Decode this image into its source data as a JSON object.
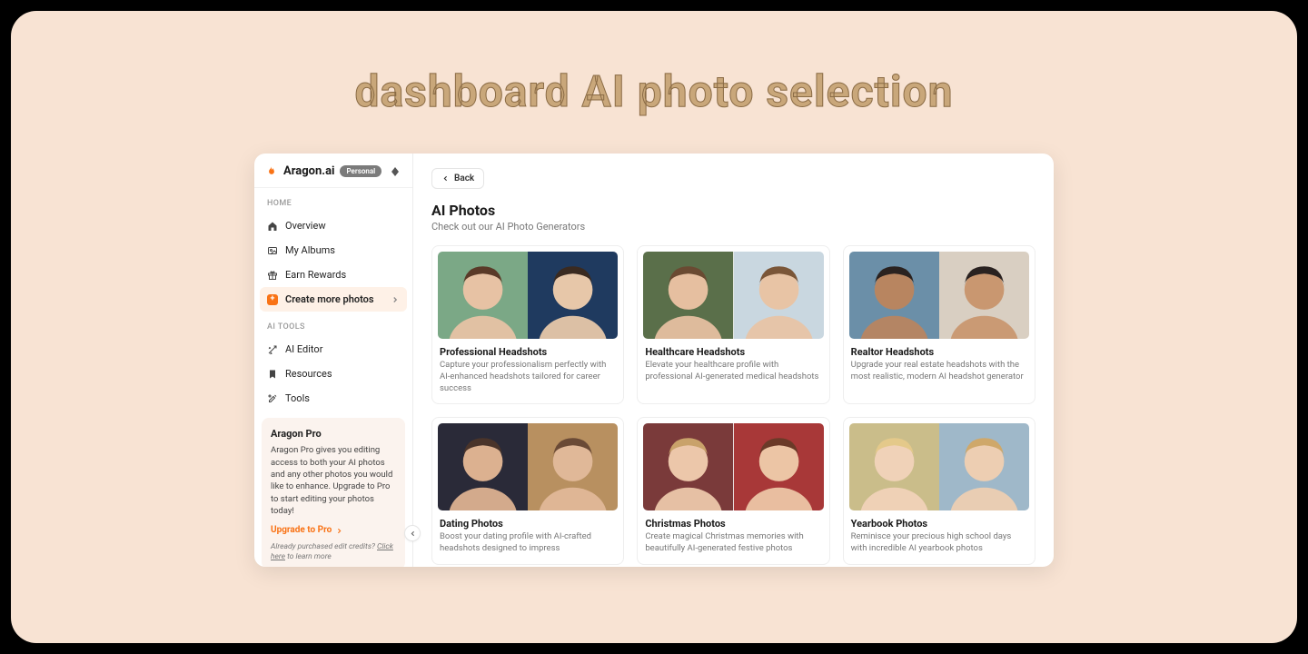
{
  "annotation": {
    "title": "dashboard AI photo selection"
  },
  "brand": {
    "name": "Aragon.ai",
    "badge": "Personal"
  },
  "sidebar": {
    "home_label": "HOME",
    "aitools_label": "AI TOOLS",
    "items": {
      "overview": "Overview",
      "my_albums": "My Albums",
      "earn_rewards": "Earn Rewards",
      "create_more": "Create more photos",
      "ai_editor": "AI Editor",
      "resources": "Resources",
      "tools": "Tools"
    },
    "pro": {
      "title": "Aragon Pro",
      "body": "Aragon Pro gives you editing access to both your AI photos and any other photos you would like to enhance. Upgrade to Pro to start editing your photos today!",
      "cta": "Upgrade to Pro",
      "fineprint_prefix": "Already purchased edit credits? ",
      "fineprint_link": "Click here",
      "fineprint_suffix": " to learn more"
    }
  },
  "main": {
    "back": "Back",
    "title": "AI Photos",
    "subtitle": "Check out our AI Photo Generators",
    "cards": [
      {
        "title": "Professional Headshots",
        "desc": "Capture your professionalism perfectly with AI-enhanced headshots tailored for career success"
      },
      {
        "title": "Healthcare Headshots",
        "desc": "Elevate your healthcare profile with professional AI-generated medical headshots"
      },
      {
        "title": "Realtor Headshots",
        "desc": "Upgrade your real estate headshots with the most realistic, modern AI headshot generator"
      },
      {
        "title": "Dating Photos",
        "desc": "Boost your dating profile with AI-crafted headshots designed to impress"
      },
      {
        "title": "Christmas Photos",
        "desc": "Create magical Christmas memories with beautifully AI-generated festive photos"
      },
      {
        "title": "Yearbook Photos",
        "desc": "Reminisce your precious high school days with incredible AI yearbook photos"
      }
    ]
  },
  "card_colors": [
    [
      "#7ba886",
      "#1f3a5f"
    ],
    [
      "#5a6f4a",
      "#c9d7e0"
    ],
    [
      "#6b8fa8",
      "#d9cfc2"
    ],
    [
      "#2a2a38",
      "#b89060"
    ],
    [
      "#7a3a3a",
      "#a83838"
    ],
    [
      "#cabd8a",
      "#9fb8c9"
    ]
  ],
  "skin_tones": [
    [
      "#e7c2a4",
      "#e7c7a9"
    ],
    [
      "#e6bfa0",
      "#e8c4a5"
    ],
    [
      "#b88560",
      "#c99770"
    ],
    [
      "#dcb190",
      "#e0b898"
    ],
    [
      "#ecc7aa",
      "#ecc5a5"
    ],
    [
      "#f0d2b8",
      "#edceb2"
    ]
  ],
  "hair_tones": [
    [
      "#5a3a28",
      "#3a2a20"
    ],
    [
      "#6a4a32",
      "#7a5638"
    ],
    [
      "#2a2220",
      "#2a2220"
    ],
    [
      "#4a342a",
      "#6a4a36"
    ],
    [
      "#c9a26a",
      "#6a3a28"
    ],
    [
      "#e4c98a",
      "#cfa86a"
    ]
  ]
}
